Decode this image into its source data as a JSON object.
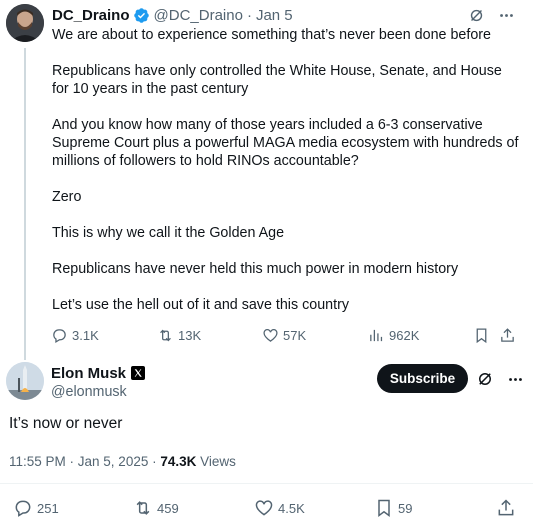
{
  "reply": {
    "name": "DC_Draino",
    "handle": "@DC_Draino",
    "separator": "·",
    "time": "Jan 5",
    "paragraphs": [
      "We are about to experience something that’s never been done before",
      "Republicans have only controlled the White House, Senate, and House for 10 years in the past century",
      "And you know how many of those years included a 6-3 conservative Supreme Court plus a powerful MAGA media ecosystem with hundreds of millions of followers to hold RINOs accountable?",
      "Zero",
      "This is why we call it the Golden Age",
      "Republicans have never held this much power in modern history",
      "Let’s use the hell out of it and save this country"
    ],
    "stats": {
      "replies": "3.1K",
      "reposts": "13K",
      "likes": "57K",
      "views": "962K"
    }
  },
  "main": {
    "name": "Elon Musk",
    "handle": "@elonmusk",
    "subscribe_label": "Subscribe",
    "text": "It’s now or never",
    "time": "11:55 PM · Jan 5, 2025 · ",
    "views_count": "74.3K",
    "views_label": " Views",
    "stats": {
      "replies": "251",
      "reposts": "459",
      "likes": "4.5K",
      "bookmarks": "59"
    }
  },
  "colors": {
    "verified": "#1d9bf0",
    "secondary_text": "#536471",
    "primary_text": "#0f1419"
  },
  "icons": [
    "grok-icon",
    "more-icon",
    "reply-icon",
    "repost-icon",
    "like-icon",
    "views-icon",
    "bookmark-icon",
    "share-icon",
    "verified-icon",
    "x-affiliate-badge"
  ]
}
